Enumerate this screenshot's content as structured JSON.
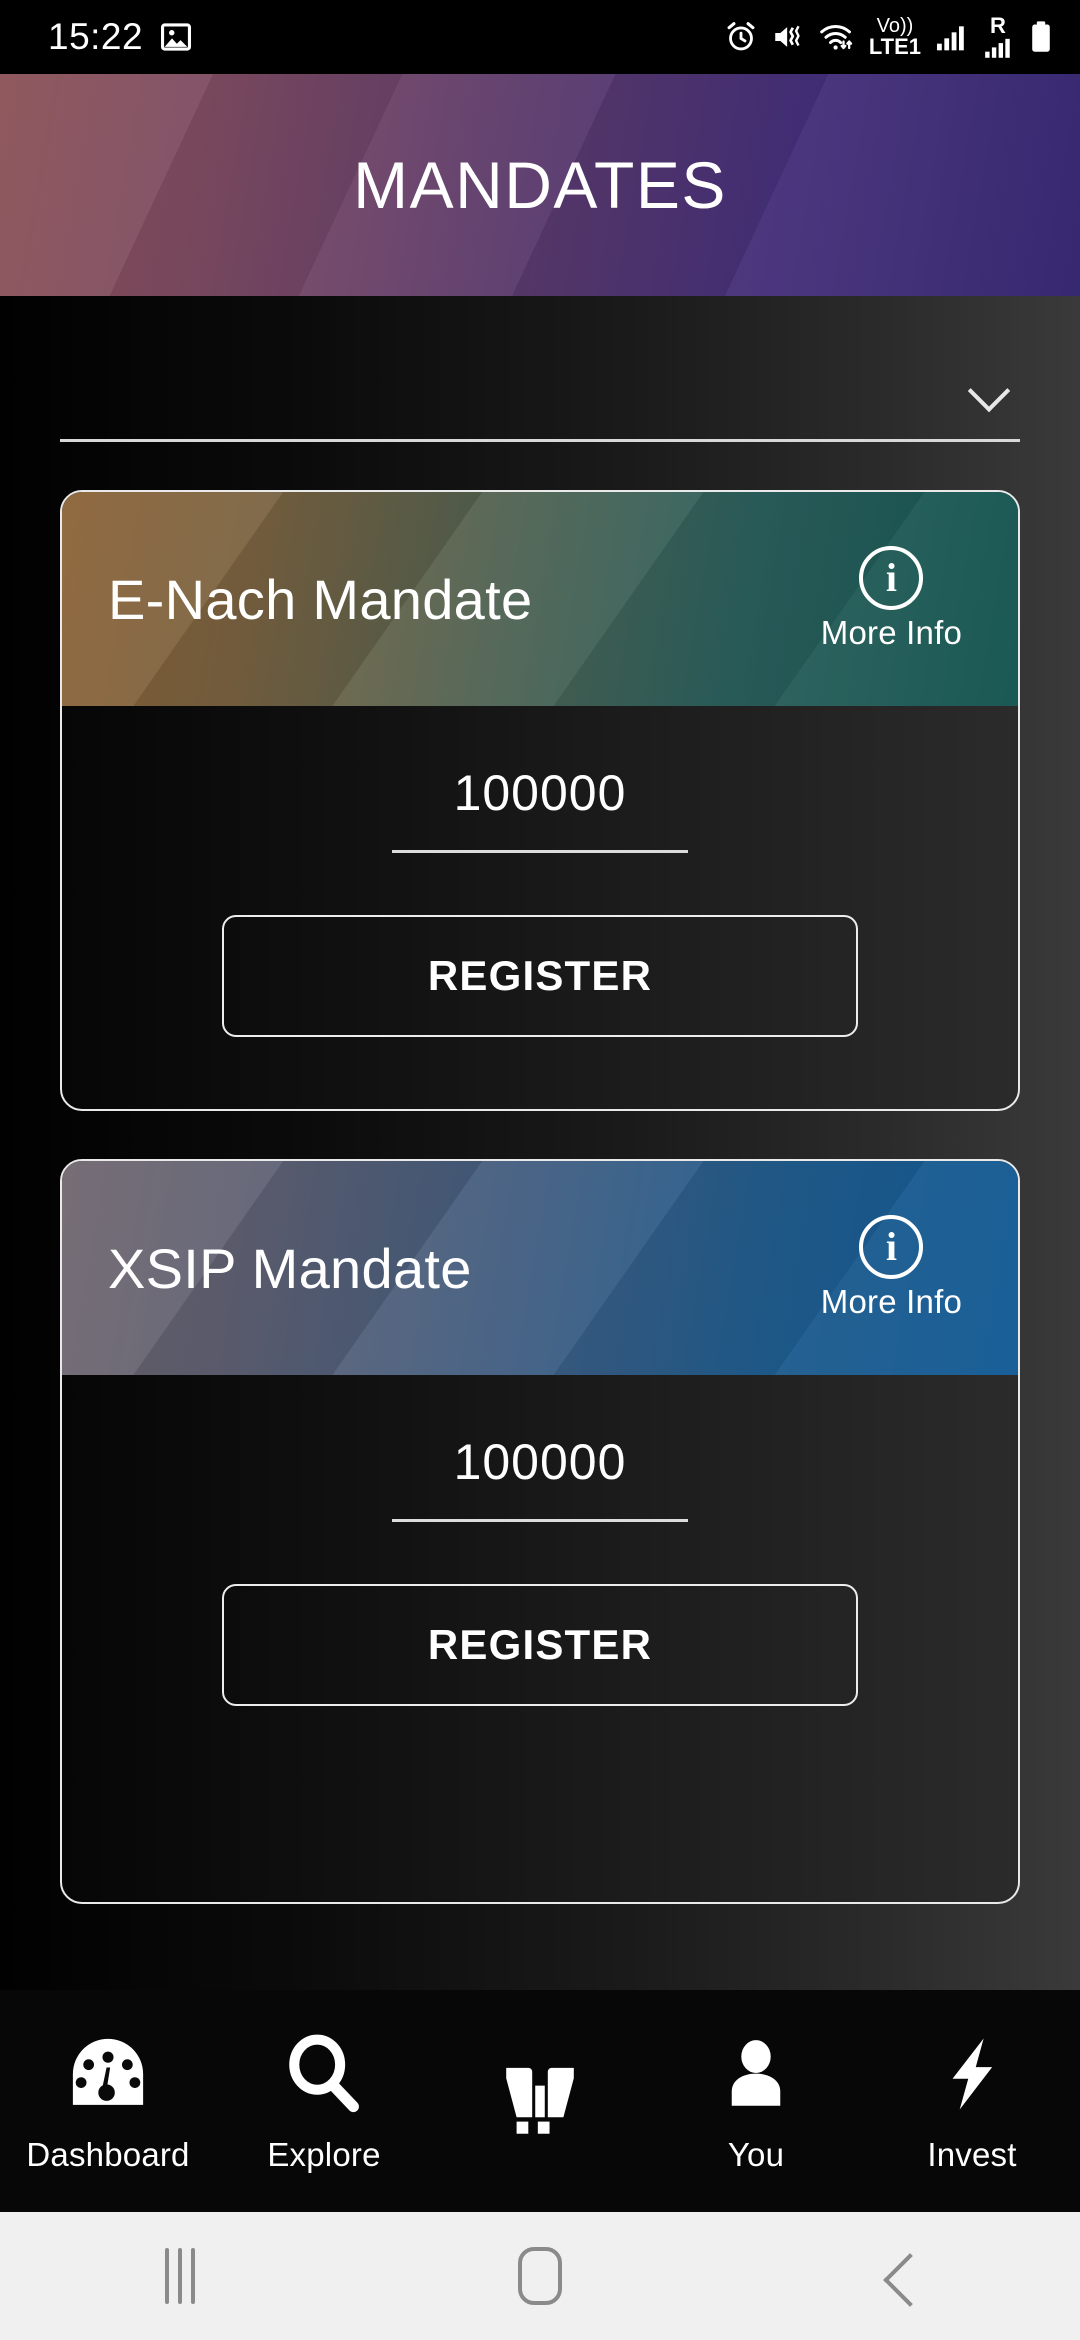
{
  "status_bar": {
    "time": "15:22",
    "left_icons": [
      "image-icon"
    ],
    "right_icons": [
      "alarm-icon",
      "mute-vibrate-icon",
      "wifi-data-icon",
      "volte1-icon",
      "signal-bars-icon",
      "roaming-signal-icon",
      "battery-icon"
    ],
    "network_label": "Vo))",
    "network_sub": "LTE1",
    "roaming_label": "R"
  },
  "app_bar": {
    "title": "MANDATES",
    "gradient_from": "#8a5055",
    "gradient_to": "#30216c"
  },
  "filter": {
    "selected_value": "",
    "chevron_icon": "chevron-down-icon"
  },
  "cards": [
    {
      "title": "E-Nach Mandate",
      "more_info_label": "More Info",
      "info_icon": "info-icon",
      "amount_value": "100000",
      "register_label": "REGISTER",
      "gradient_from": "#8a6134",
      "gradient_to": "#13544f"
    },
    {
      "title": "XSIP Mandate",
      "more_info_label": "More Info",
      "info_icon": "info-icon",
      "amount_value": "100000",
      "register_label": "REGISTER",
      "gradient_from": "#6e646c",
      "gradient_to": "#125a95"
    }
  ],
  "bottom_nav": [
    {
      "label": "Dashboard",
      "icon": "gauge-icon"
    },
    {
      "label": "Explore",
      "icon": "search-icon"
    },
    {
      "label": "",
      "icon": "binoculars-icon"
    },
    {
      "label": "You",
      "icon": "person-icon"
    },
    {
      "label": "Invest",
      "icon": "lightning-bolt-icon"
    }
  ],
  "system_nav": {
    "recents_icon": "recents-icon",
    "home_icon": "home-icon",
    "back_icon": "back-icon"
  }
}
